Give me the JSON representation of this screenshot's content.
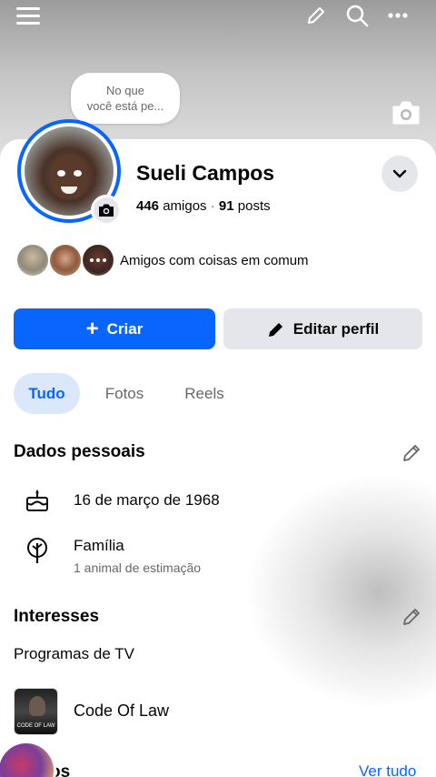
{
  "header": {
    "icons": [
      "menu-icon",
      "edit-icon",
      "search-icon",
      "more-icon"
    ]
  },
  "status_bubble": {
    "text_line1": "No que",
    "text_line2": "você está pe..."
  },
  "profile": {
    "name": "Sueli Campos",
    "friends_count": "446",
    "friends_label": "amigos",
    "separator": "·",
    "posts_count": "91",
    "posts_label": "posts"
  },
  "mutual": {
    "label": "Amigos com coisas em comum"
  },
  "actions": {
    "create_icon": "+",
    "create_label": "Criar",
    "edit_label": "Editar perfil"
  },
  "tabs": [
    {
      "label": "Tudo",
      "active": true
    },
    {
      "label": "Fotos",
      "active": false
    },
    {
      "label": "Reels",
      "active": false
    }
  ],
  "personal": {
    "title": "Dados pessoais",
    "birthday": "16 de março de 1968",
    "family_title": "Família",
    "family_sub": "1 animal de estimação"
  },
  "interests": {
    "title": "Interesses",
    "category": "Programas de TV",
    "item_name": "Code Of Law",
    "item_thumb_text": "CODE OF LAW"
  },
  "bottom": {
    "title_partial": "os",
    "see_all": "Ver tudo"
  },
  "colors": {
    "accent": "#0866ff",
    "secondary_button": "#e4e6eb",
    "active_tab_bg": "#dbe7fb",
    "muted_text": "#65676b"
  }
}
